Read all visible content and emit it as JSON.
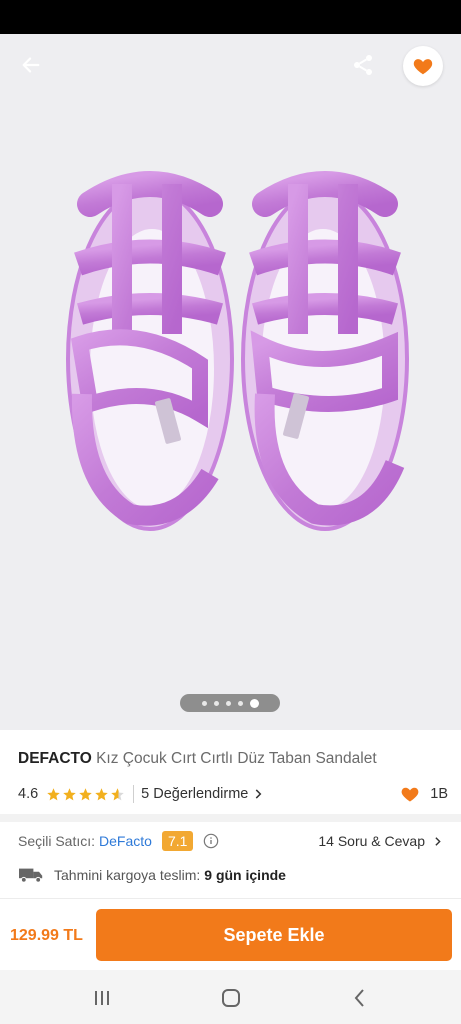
{
  "product": {
    "brand": "DEFACTO",
    "name": "Kız Çocuk Cırt Cırtlı Düz Taban Sandalet",
    "rating": "4.6",
    "rating_value": 4.6,
    "reviews_label": "5 Değerlendirme",
    "favorites_count": "1B",
    "image_count": 5,
    "active_image_index": 4
  },
  "seller": {
    "label": "Seçili Satıcı:",
    "name": "DeFacto",
    "score": "7.1",
    "qa_label": "14 Soru & Cevap"
  },
  "shipping": {
    "label": "Tahmini kargoya teslim:",
    "days": "9 gün içinde"
  },
  "purchase": {
    "price": "129.99 TL",
    "cart_button": "Sepete Ekle"
  },
  "icons": {
    "back": "arrow-left-icon",
    "share": "share-icon",
    "favorite": "heart-icon",
    "star": "star-icon",
    "info": "info-icon",
    "truck": "truck-icon",
    "nav_recent": "recent-apps-icon",
    "nav_home": "home-icon",
    "nav_back": "chevron-left-icon"
  },
  "colors": {
    "accent": "#f27a1a",
    "seller_link": "#2f7ad8",
    "seller_score_bg": "#f2a832",
    "star": "#f2b01e"
  }
}
